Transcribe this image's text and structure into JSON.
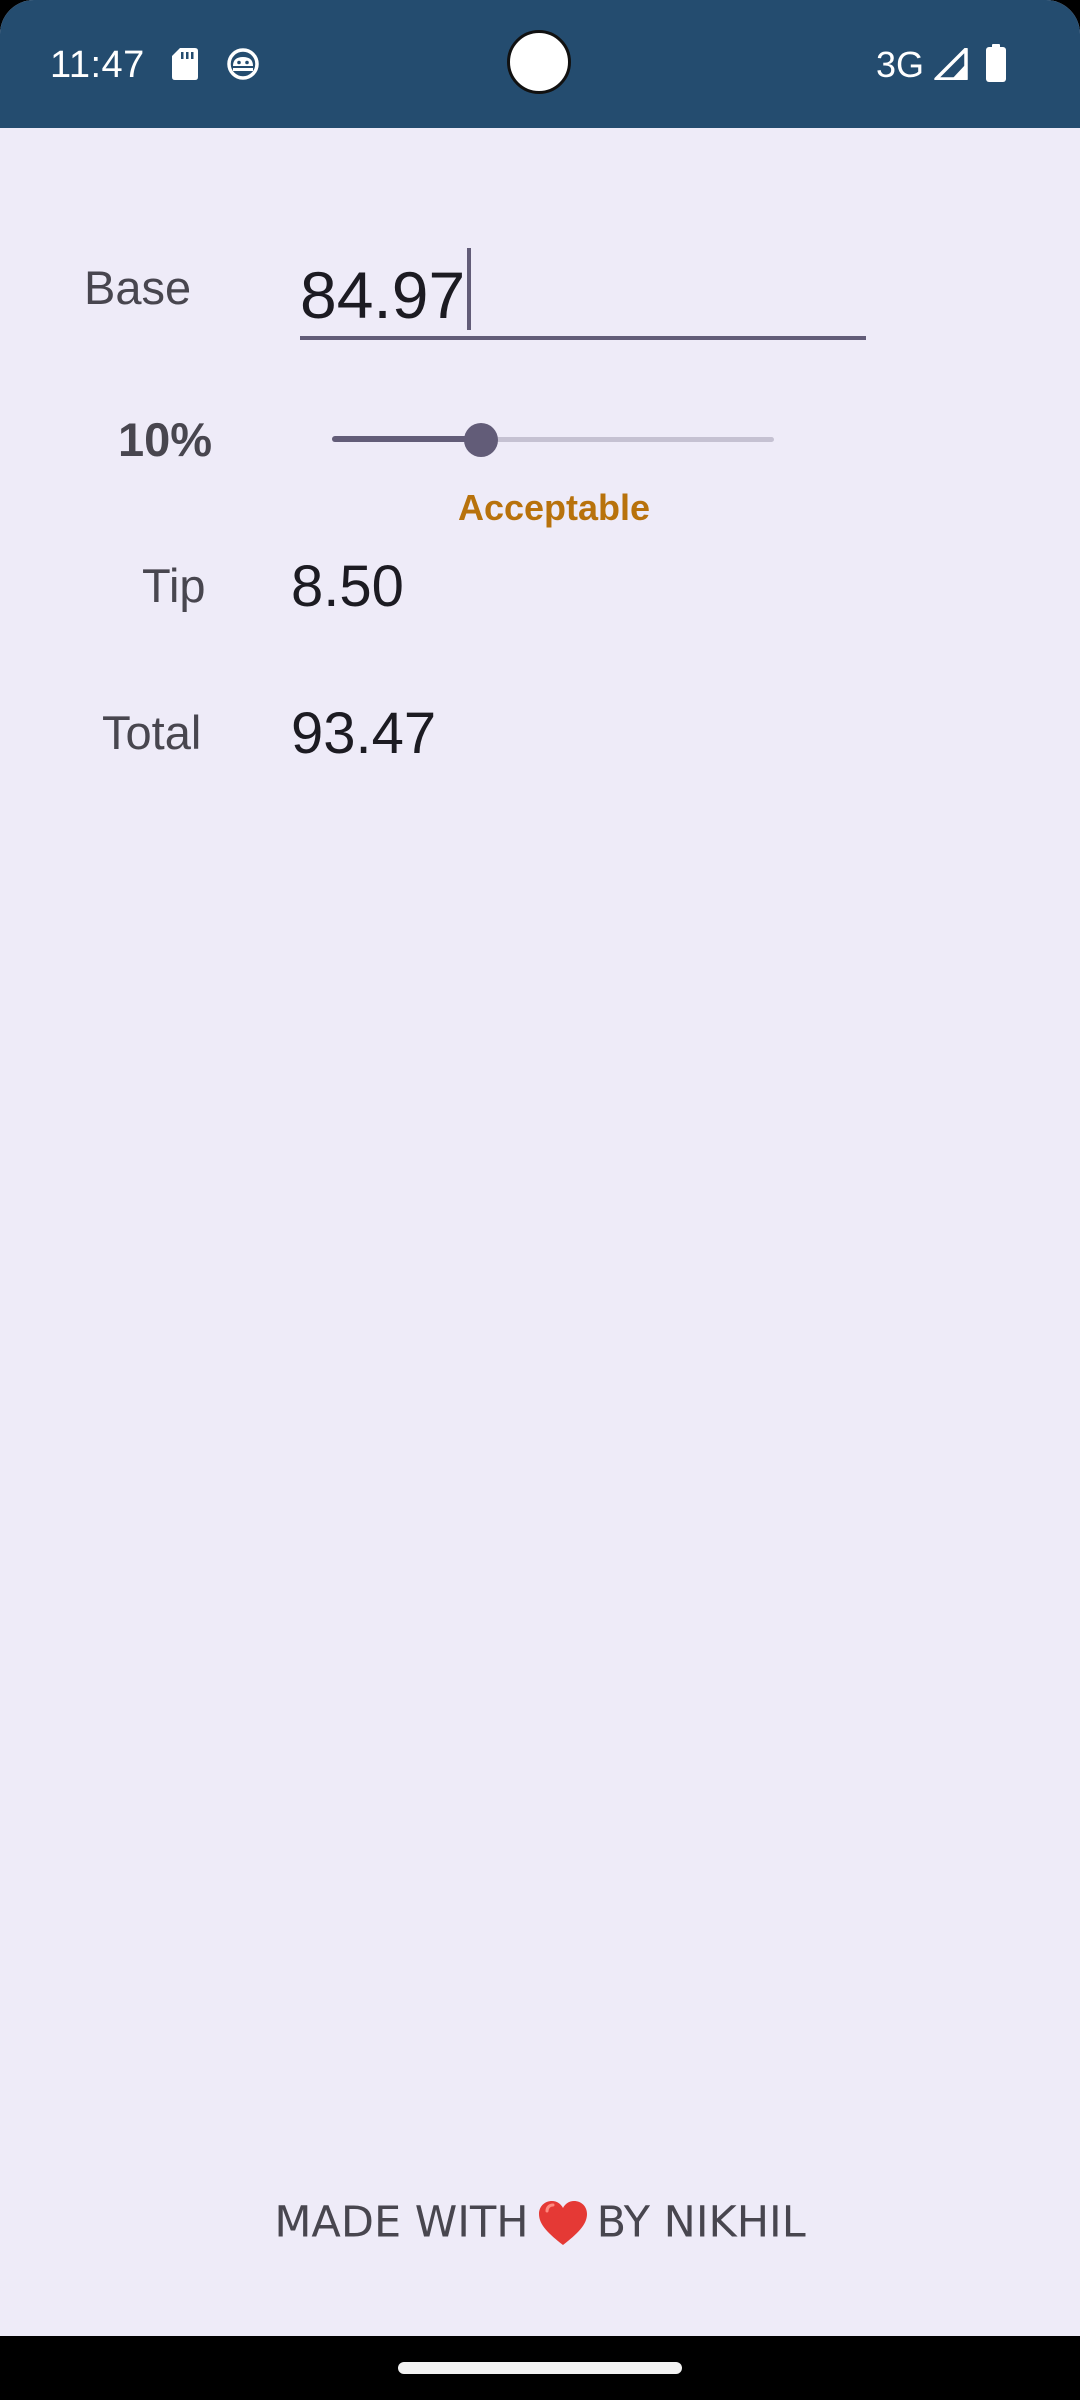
{
  "status_bar": {
    "time": "11:47",
    "network": "3G",
    "icons": [
      "sd-card-icon",
      "android-debug-icon",
      "signal-icon",
      "battery-icon"
    ],
    "background_color": "#244C6F"
  },
  "form": {
    "base_label": "Base",
    "base_value": "84.97",
    "percent_label": "10%",
    "tip_percent": 10,
    "tip_quality": "Acceptable",
    "tip_label": "Tip",
    "tip_value": "8.50",
    "total_label": "Total",
    "total_value": "93.47"
  },
  "footer": {
    "prefix": "MADE WITH",
    "icon": "heart-icon",
    "suffix": "BY NIKHIL"
  },
  "colors": {
    "background": "#EEEBF8",
    "accent": "#625C78",
    "tip_quality": "#B8720C",
    "heart": "#E53935"
  }
}
